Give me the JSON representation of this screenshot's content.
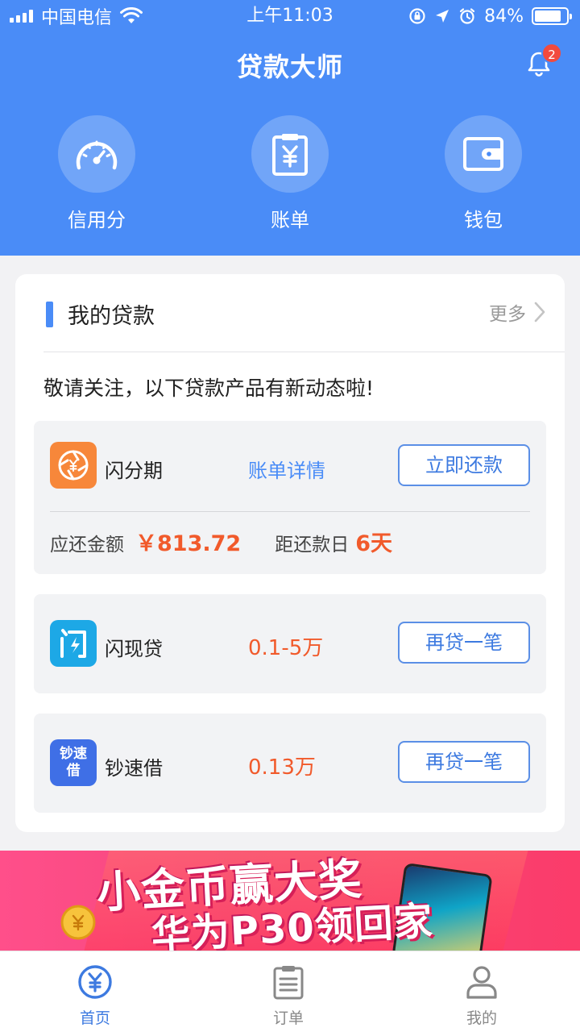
{
  "status_bar": {
    "carrier": "中国电信",
    "time": "上午11:03",
    "battery": "84%",
    "battery_level": 0.84
  },
  "nav": {
    "title": "贷款大师",
    "notification_count": "2"
  },
  "quick_actions": [
    {
      "label": "信用分",
      "icon": "gauge-icon"
    },
    {
      "label": "账单",
      "icon": "bill-icon"
    },
    {
      "label": "钱包",
      "icon": "wallet-icon"
    }
  ],
  "loans": {
    "title": "我的贷款",
    "more": "更多",
    "notice": "敬请关注，以下贷款产品有新动态啦!",
    "items": [
      {
        "name": "闪分期",
        "link": "账单详情",
        "action": "立即还款",
        "due_label": "应还金额",
        "due_amount": "￥813.72",
        "days_label": "距还款日",
        "days": "6天"
      },
      {
        "name": "闪现贷",
        "range": "0.1-5万",
        "action": "再贷一笔"
      },
      {
        "name": "钞速借",
        "range": "0.13万",
        "action": "再贷一笔",
        "logo_text": "钞速借"
      }
    ]
  },
  "banner": {
    "line1": "小金币赢大奖",
    "line2": "华为P30领回家"
  },
  "tabbar": [
    {
      "label": "首页",
      "icon": "home-yen-icon",
      "active": true
    },
    {
      "label": "订单",
      "icon": "orders-icon",
      "active": false
    },
    {
      "label": "我的",
      "icon": "profile-icon",
      "active": false
    }
  ],
  "colors": {
    "primary": "#4a8cf7",
    "accent_orange": "#f15a2b",
    "badge_red": "#f24a3e"
  }
}
